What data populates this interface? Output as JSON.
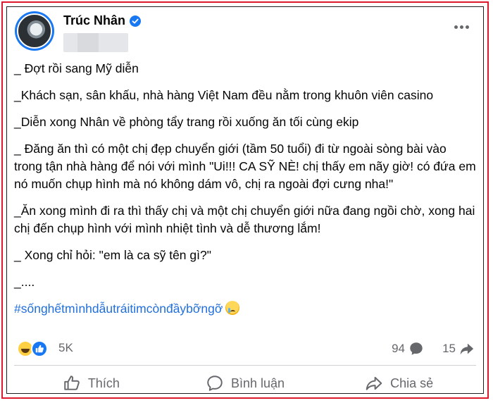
{
  "post": {
    "author": "Trúc Nhân",
    "paragraphs": [
      "_ Đợt rồi sang Mỹ diễn",
      "_Khách sạn, sân khấu, nhà hàng Việt Nam đều nằm trong khuôn viên casino",
      "_Diễn xong Nhân về phòng tẩy trang rồi xuống ăn tối cùng ekip",
      "_ Đăng ăn thì có một chị đẹp chuyển giới (tầm 50 tuổi) đi từ ngoài sòng bài vào trong tận nhà hàng để nói với mình \"Ui!!! CA SỸ NÈ! chị thấy em nãy giờ! có đứa em nó muốn chụp hình mà nó không dám vô, chị ra ngoài đợi cưng nha!\"",
      "_Ăn xong mình đi ra thì thấy chị và một chị chuyển giới nữa đang ngồi chờ, xong hai chị đến chụp hình với mình nhiệt tình và dễ thương lắm!",
      "_ Xong chỉ hỏi: \"em là ca sỹ tên gì?\"",
      "_...."
    ],
    "hashtag": "#sốnghếtmìnhdẫutráitimcònđầybỡngỡ"
  },
  "stats": {
    "reactions": "5K",
    "comments": "94",
    "shares": "15"
  },
  "actions": {
    "like_label": "Thích",
    "comment_label": "Bình luận",
    "share_label": "Chia sẻ"
  },
  "colors": {
    "accent": "#1877f2",
    "hashtag": "#216fdb",
    "border_highlight": "#e0182d",
    "muted_text": "#65676b"
  }
}
